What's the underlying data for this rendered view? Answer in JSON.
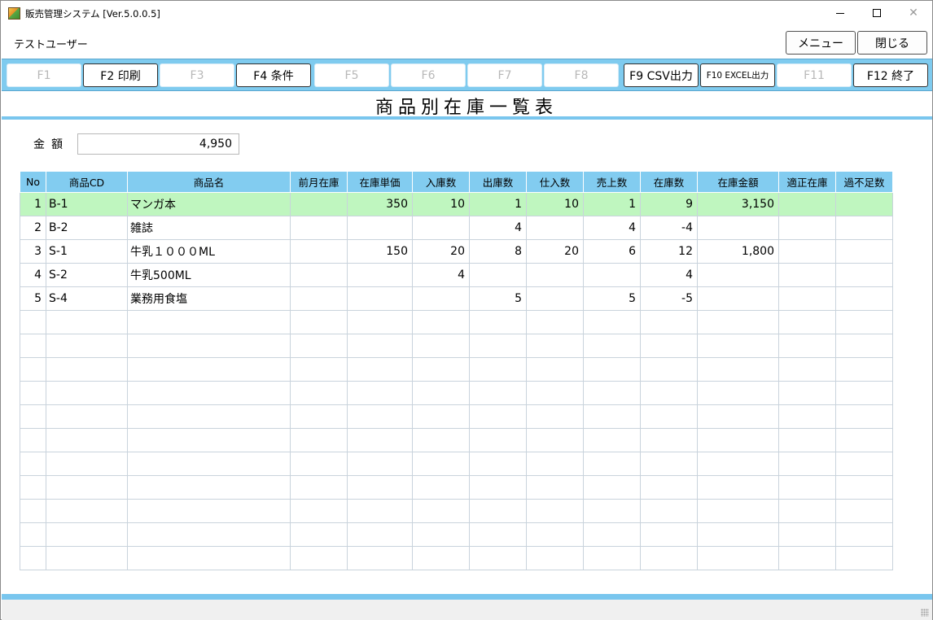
{
  "window": {
    "title": "販売管理システム [Ver.5.0.0.5]",
    "controls": {
      "minimize": "minimize-icon",
      "maximize": "maximize-icon",
      "close": "✕"
    }
  },
  "header": {
    "user": "テストユーザー",
    "menu_label": "メニュー",
    "close_label": "閉じる"
  },
  "function_keys": [
    {
      "label": "F1",
      "enabled": false
    },
    {
      "label": "F2 印刷",
      "enabled": true
    },
    {
      "label": "F3",
      "enabled": false
    },
    {
      "label": "F4 条件",
      "enabled": true
    },
    {
      "label": "F5",
      "enabled": false
    },
    {
      "label": "F6",
      "enabled": false
    },
    {
      "label": "F7",
      "enabled": false
    },
    {
      "label": "F8",
      "enabled": false
    },
    {
      "label": "F9 CSV出力",
      "enabled": true
    },
    {
      "label": "F10 EXCEL出力",
      "enabled": true
    },
    {
      "label": "F11",
      "enabled": false
    },
    {
      "label": "F12 終了",
      "enabled": true
    }
  ],
  "report_title": "商品別在庫一覧表",
  "amount": {
    "label": "金額",
    "value": "4,950"
  },
  "table": {
    "columns": [
      "No",
      "商品CD",
      "商品名",
      "前月在庫",
      "在庫単価",
      "入庫数",
      "出庫数",
      "仕入数",
      "売上数",
      "在庫数",
      "在庫金額",
      "適正在庫",
      "過不足数"
    ],
    "rows": [
      [
        "1",
        "B-1",
        "マンガ本",
        "",
        "350",
        "10",
        "1",
        "10",
        "1",
        "9",
        "3,150",
        "",
        ""
      ],
      [
        "2",
        "B-2",
        "雑誌",
        "",
        "",
        "",
        "4",
        "",
        "4",
        "-4",
        "",
        "",
        ""
      ],
      [
        "3",
        "S-1",
        "牛乳１０００ML",
        "",
        "150",
        "20",
        "8",
        "20",
        "6",
        "12",
        "1,800",
        "",
        ""
      ],
      [
        "4",
        "S-2",
        "牛乳500ML",
        "",
        "",
        "4",
        "",
        "",
        "",
        "4",
        "",
        "",
        ""
      ],
      [
        "5",
        "S-4",
        "業務用食塩",
        "",
        "",
        "",
        "5",
        "",
        "5",
        "-5",
        "",
        "",
        ""
      ]
    ],
    "selected_row": 0,
    "empty_rows": 11
  },
  "colors": {
    "accent": "#79c6ee",
    "header_bg": "#82ccf0",
    "selected_row": "#bff6bf"
  }
}
